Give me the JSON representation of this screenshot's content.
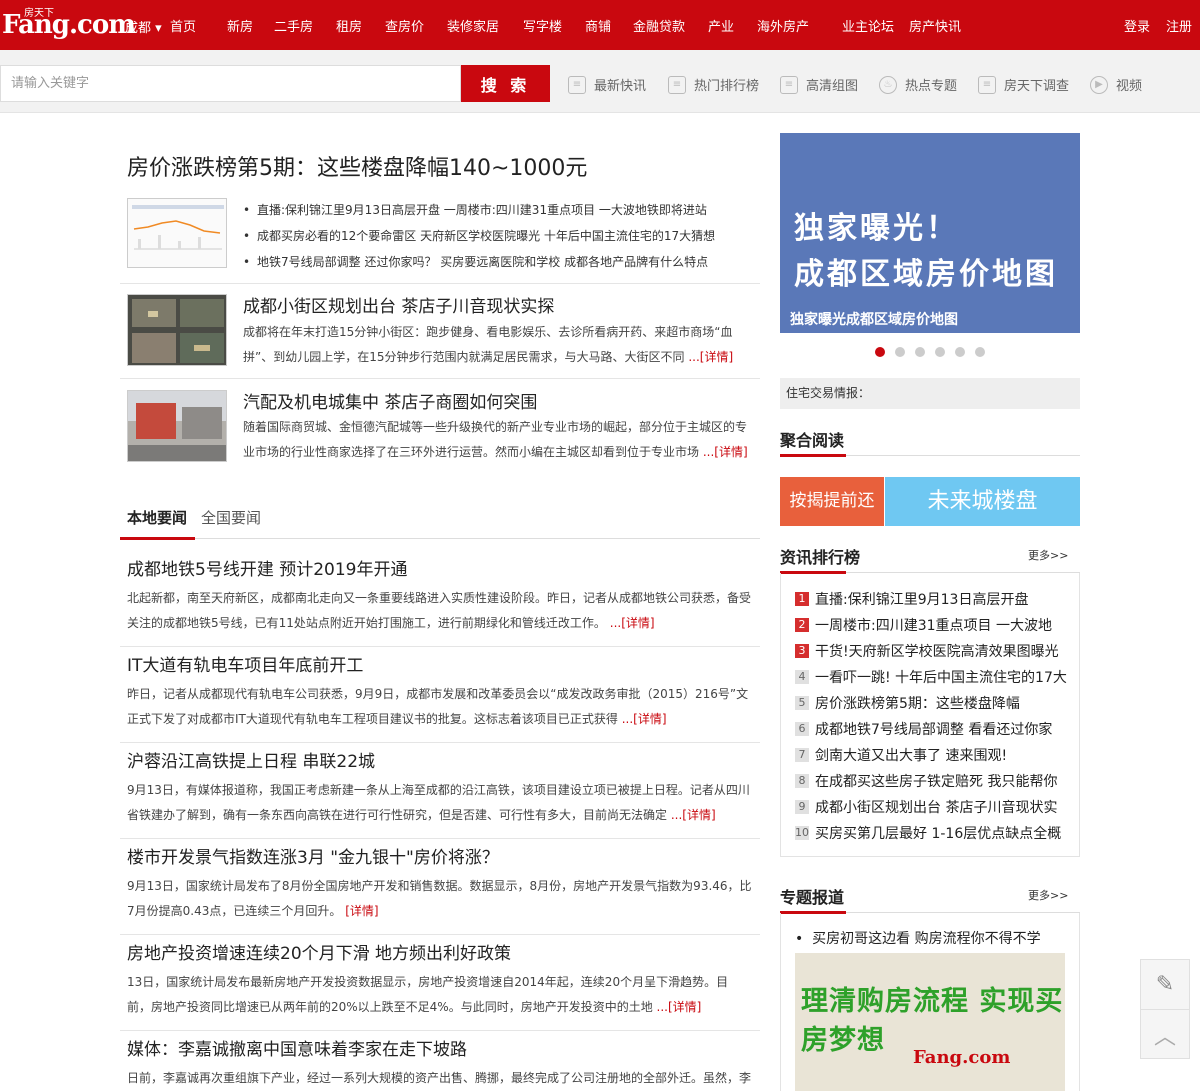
{
  "brand": {
    "logo_text": "Fang.com",
    "logo_sub": "房天下"
  },
  "nav": {
    "city": "成都",
    "items": [
      "首页",
      "新房",
      "二手房",
      "租房",
      "查房价",
      "装修家居",
      "写字楼",
      "商铺",
      "金融贷款",
      "产业",
      "海外房产",
      "业主论坛",
      "房产快讯"
    ],
    "login": "登录",
    "register": "注册"
  },
  "search": {
    "placeholder": "请输入关键字",
    "button": "搜 索"
  },
  "quick_links": [
    {
      "label": "最新快讯",
      "icon": "list-icon"
    },
    {
      "label": "热门排行榜",
      "icon": "ranking-icon"
    },
    {
      "label": "高清组图",
      "icon": "image-icon"
    },
    {
      "label": "热点专题",
      "icon": "fire-icon"
    },
    {
      "label": "房天下调查",
      "icon": "survey-icon"
    },
    {
      "label": "视频",
      "icon": "play-icon"
    }
  ],
  "headline": {
    "title": "房价涨跌榜第5期：这些楼盘降幅140~1000元",
    "bullets": [
      "直播:保利锦江里9月13日高层开盘  一周楼市:四川建31重点项目  一大波地铁即将进站",
      "成都买房必看的12个要命雷区  天府新区学校医院曝光  十年后中国主流住宅的17大猜想",
      "地铁7号线局部调整  还过你家吗？  买房要远离医院和学校  成都各地产品牌有什么特点"
    ]
  },
  "articles": [
    {
      "title": "成都小街区规划出台 茶店子川音现状实探",
      "desc": "成都将在年末打造15分钟小街区：跑步健身、看电影娱乐、去诊所看病开药、来超市商场“血拼”、到幼儿园上学，在15分钟步行范围内就满足居民需求，与大马路、大街区不同",
      "more": "...[详情]"
    },
    {
      "title": "汽配及机电城集中 茶店子商圈如何突围",
      "desc": "随着国际商贸城、金恒德汽配城等一些升级换代的新产业专业市场的崛起，部分位于主城区的专业市场的行业性商家选择了在三环外进行运营。然而小编在主城区却看到位于专业市场",
      "more": "...[详情]"
    }
  ],
  "tabs": [
    "本地要闻",
    "全国要闻"
  ],
  "news": [
    {
      "title": "成都地铁5号线开建 预计2019年开通",
      "desc": "北起新都，南至天府新区，成都南北走向又一条重要线路进入实质性建设阶段。昨日，记者从成都地铁公司获悉，备受关注的成都地铁5号线，已有11处站点附近开始打围施工，进行前期绿化和管线迁改工作。",
      "more": "...[详情]"
    },
    {
      "title": "IT大道有轨电车项目年底前开工",
      "desc": "昨日，记者从成都现代有轨电车公司获悉，9月9日，成都市发展和改革委员会以“成发改政务审批（2015）216号”文正式下发了对成都市IT大道现代有轨电车工程项目建议书的批复。这标志着该项目已正式获得",
      "more": "...[详情]"
    },
    {
      "title": "沪蓉沿江高铁提上日程 串联22城",
      "desc": "9月13日，有媒体报道称，我国正考虑新建一条从上海至成都的沿江高铁，该项目建设立项已被提上日程。记者从四川省铁建办了解到，确有一条东西向高铁在进行可行性研究，但是否建、可行性有多大，目前尚无法确定",
      "more": "...[详情]"
    },
    {
      "title": "楼市开发景气指数连涨3月 \"金九银十\"房价将涨？",
      "desc": "9月13日，国家统计局发布了8月份全国房地产开发和销售数据。数据显示，8月份，房地产开发景气指数为93.46，比7月份提高0.43点，已连续三个月回升。",
      "more": "[详情]"
    },
    {
      "title": "房地产投资增速连续20个月下滑 地方频出利好政策",
      "desc": "13日，国家统计局发布最新房地产开发投资数据显示，房地产投资增速自2014年起，连续20个月呈下滑趋势。目前，房地产投资同比增速已从两年前的20%以上跌至不足4%。与此同时，房地产开发投资中的土地",
      "more": "...[详情]"
    },
    {
      "title": "媒体：李嘉诚撤离中国意味着李家在走下坡路",
      "desc": "日前，李嘉诚再次重组旗下产业，经过一系列大规模的资产出售、腾挪，最终完成了公司注册地的全部外迁。虽然，李",
      "more": ""
    }
  ],
  "banner": {
    "line1": "独家曝光！",
    "line2": "成都区域房价地图",
    "caption": "独家曝光成都区域房价地图",
    "slides": 6,
    "active_slide": 1
  },
  "trade": {
    "label": "住宅交易情报："
  },
  "aggregate": {
    "title": "聚合阅读",
    "tile1": "按揭提前还",
    "tile2": "未来城楼盘"
  },
  "ranking": {
    "title": "资讯排行榜",
    "more": "更多>>",
    "items": [
      "直播:保利锦江里9月13日高层开盘",
      "一周楼市:四川建31重点项目 一大波地",
      "干货!天府新区学校医院高清效果图曝光",
      "一看吓一跳! 十年后中国主流住宅的17大",
      "房价涨跌榜第5期：这些楼盘降幅",
      "成都地铁7号线局部调整 看看还过你家",
      "剑南大道又出大事了 速来围观!",
      "在成都买这些房子铁定赔死 我只能帮你",
      "成都小街区规划出台 茶店子川音现状实",
      "买房买第几层最好 1-16层优点缺点全概"
    ],
    "numbers": [
      "1",
      "2",
      "3",
      "4",
      "5",
      "6",
      "7",
      "8",
      "9",
      "10"
    ]
  },
  "special": {
    "title": "专题报道",
    "more": "更多>>",
    "item": "买房初哥这边看 购房流程你不得不学",
    "img_text": "理清购房流程 实现买房梦想",
    "img_logo": "Fang.com"
  },
  "colors": {
    "brand_red": "#c9080f",
    "banner_blue": "#5a78b8",
    "tile_orange": "#e8603c",
    "tile_blue": "#6fc8f2"
  }
}
